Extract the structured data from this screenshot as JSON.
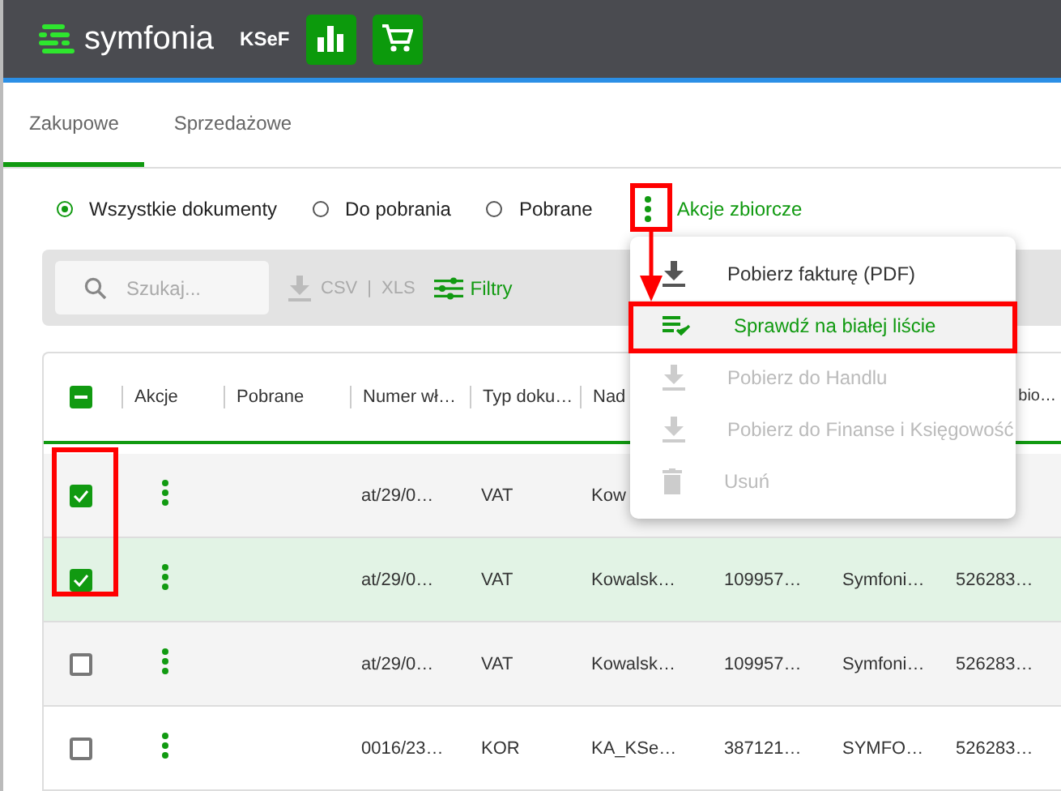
{
  "header": {
    "logo": "symfonia",
    "app": "KSeF"
  },
  "tabs": [
    {
      "label": "Zakupowe",
      "selected": true
    },
    {
      "label": "Sprzedażowe",
      "selected": false
    }
  ],
  "filters": [
    {
      "label": "Wszystkie dokumenty",
      "selected": true
    },
    {
      "label": "Do pobrania",
      "selected": false
    },
    {
      "label": "Pobrane",
      "selected": false
    }
  ],
  "bulk_actions": {
    "label": "Akcje zbiorcze"
  },
  "toolbar": {
    "search": {
      "placeholder": "Szukaj..."
    },
    "csv": "CSV",
    "separator": "|",
    "xls": "XLS",
    "filter": "Filtry"
  },
  "table": {
    "select_all": {
      "indeterminate": true
    },
    "columns": [
      "Akcje",
      "Pobrane",
      "Numer wł…",
      "Typ doku…",
      "Nad"
    ],
    "partial_column": "bio…",
    "rows": [
      {
        "checked": true,
        "hovered": false,
        "cells": [
          "",
          "",
          "at/29/0…",
          "VAT",
          "Kow"
        ]
      },
      {
        "checked": true,
        "hovered": true,
        "cells": [
          "",
          "",
          "at/29/0…",
          "VAT",
          "Kowalsk…",
          "109957…",
          "Symfoni…",
          "526283…"
        ]
      },
      {
        "checked": false,
        "hovered": false,
        "cells": [
          "",
          "",
          "at/29/0…",
          "VAT",
          "Kowalsk…",
          "109957…",
          "Symfoni…",
          "526283…"
        ]
      },
      {
        "checked": false,
        "hovered": false,
        "cells": [
          "",
          "",
          "0016/23…",
          "KOR",
          "KA_KSe…",
          "387121…",
          "SYMFO…",
          "526283…"
        ]
      }
    ]
  },
  "menu": {
    "items": [
      {
        "label": "Pobierz fakturę (PDF)",
        "kind": "download",
        "disabled": false,
        "selected": false
      },
      {
        "label": "Sprawdź na białej liście",
        "kind": "checklist",
        "disabled": false,
        "selected": true
      },
      {
        "label": "Pobierz do Handlu",
        "kind": "download",
        "disabled": true,
        "selected": false
      },
      {
        "label": "Pobierz do Finanse i Księgowość",
        "kind": "download",
        "disabled": true,
        "selected": false
      },
      {
        "label": "Usuń",
        "kind": "delete",
        "disabled": true,
        "selected": false
      }
    ]
  }
}
